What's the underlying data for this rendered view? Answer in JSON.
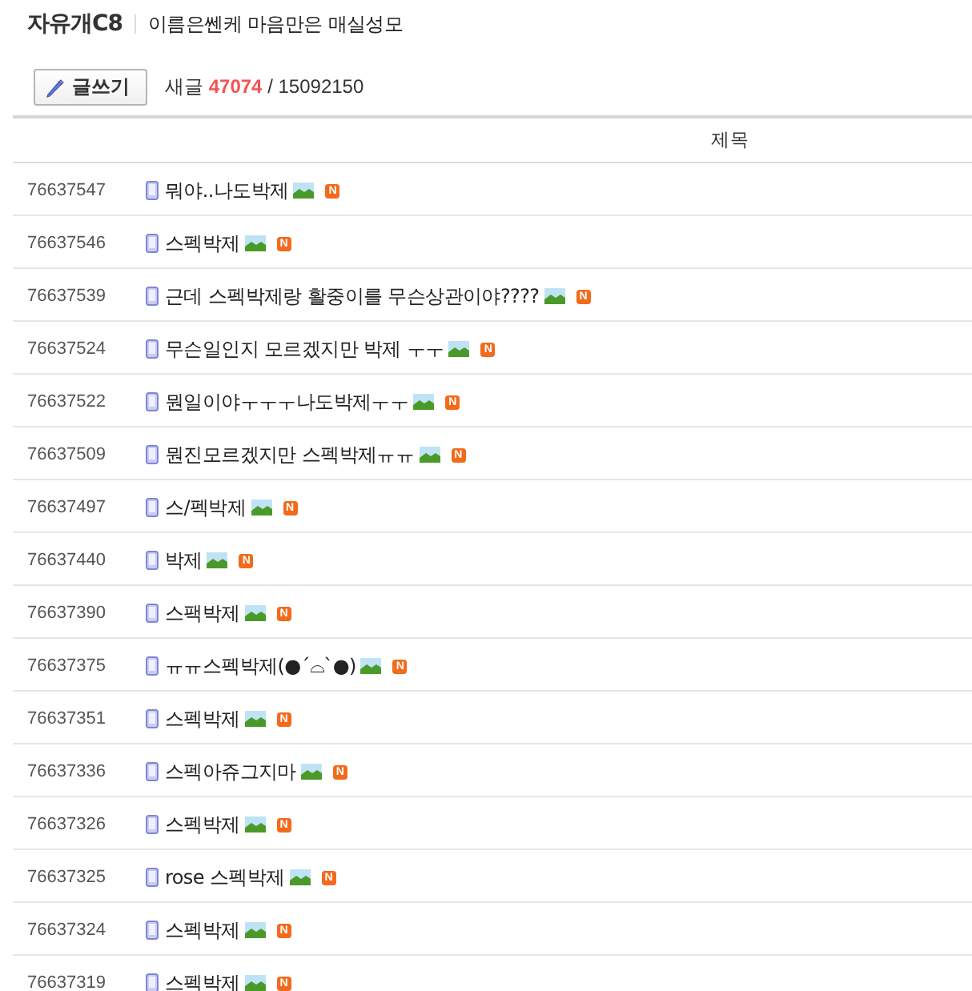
{
  "board": {
    "title": "자유개C8",
    "subtitle": "이름은쎈케 마음만은 매실성모"
  },
  "toolbar": {
    "write_button": "글쓰기",
    "new_label": "새글",
    "new_count": "47074",
    "separator": "/",
    "total_count": "15092150"
  },
  "table": {
    "columns": [
      "제목"
    ],
    "rows": [
      {
        "number": "76637547",
        "title": {
          "mobile": true,
          "text": "뭐야..나도박제",
          "has_image": true,
          "badge": "N"
        }
      },
      {
        "number": "76637546",
        "title": {
          "mobile": true,
          "text": "스펙박제",
          "has_image": true,
          "badge": "N"
        }
      },
      {
        "number": "76637539",
        "title": {
          "mobile": true,
          "text": "근데 스펙박제랑 활중이를 무슨상관이야????",
          "has_image": true,
          "badge": "N"
        }
      },
      {
        "number": "76637524",
        "title": {
          "mobile": true,
          "text": "무슨일인지 모르겠지만 박제 ㅜㅜ",
          "has_image": true,
          "badge": "N"
        }
      },
      {
        "number": "76637522",
        "title": {
          "mobile": true,
          "text": "뭔일이야ㅜㅜㅜ나도박제ㅜㅜ",
          "has_image": true,
          "badge": "N"
        }
      },
      {
        "number": "76637509",
        "title": {
          "mobile": true,
          "text": "뭔진모르겠지만 스펙박제ㅠㅠ",
          "has_image": true,
          "badge": "N"
        }
      },
      {
        "number": "76637497",
        "title": {
          "mobile": true,
          "text": "스/펙박제",
          "has_image": true,
          "badge": "N"
        }
      },
      {
        "number": "76637440",
        "title": {
          "mobile": true,
          "text": "박제",
          "has_image": true,
          "badge": "N"
        }
      },
      {
        "number": "76637390",
        "title": {
          "mobile": true,
          "text": "스팩박제",
          "has_image": true,
          "badge": "N"
        }
      },
      {
        "number": "76637375",
        "title": {
          "mobile": true,
          "text": "ㅠㅠ스펙박제(●´⌓`●)",
          "has_image": true,
          "badge": "N"
        }
      },
      {
        "number": "76637351",
        "title": {
          "mobile": true,
          "text": "스펙박제",
          "has_image": true,
          "badge": "N"
        }
      },
      {
        "number": "76637336",
        "title": {
          "mobile": true,
          "text": "스펙아쥬그지마",
          "has_image": true,
          "badge": "N"
        }
      },
      {
        "number": "76637326",
        "title": {
          "mobile": true,
          "text": "스펙박제",
          "has_image": true,
          "badge": "N"
        }
      },
      {
        "number": "76637325",
        "title": {
          "mobile": true,
          "text": "rose 스펙박제",
          "has_image": true,
          "badge": "N"
        }
      },
      {
        "number": "76637324",
        "title": {
          "mobile": true,
          "text": "스펙박제",
          "has_image": true,
          "badge": "N"
        }
      },
      {
        "number": "76637319",
        "title": {
          "mobile": true,
          "text": "스펙박제",
          "has_image": true,
          "badge": "N"
        }
      }
    ]
  }
}
